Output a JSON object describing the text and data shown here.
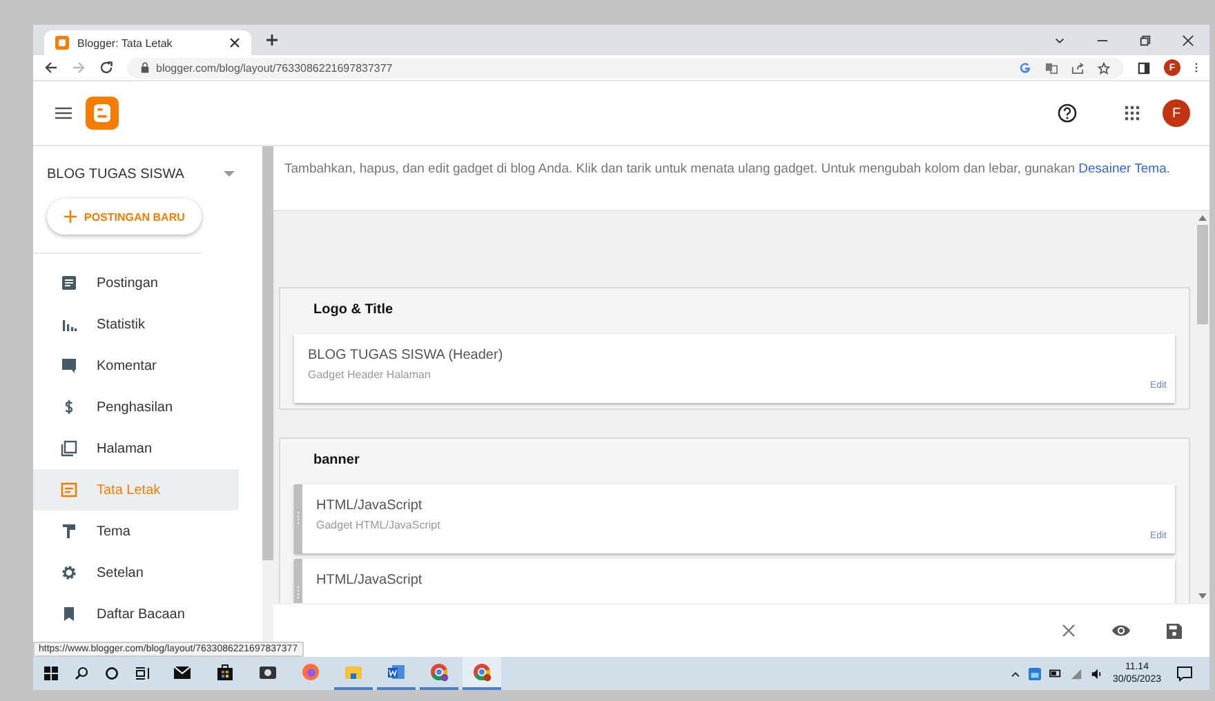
{
  "browser": {
    "tabs": [
      {
        "title": "Blogger: Tata Letak",
        "selected": true
      }
    ],
    "url": "blogger.com/blog/layout/7633086221697837377",
    "profile_initial": "F"
  },
  "header": {
    "avatar_initial": "F"
  },
  "sidebar": {
    "blog_title": "BLOG TUGAS SISWA",
    "new_post_button": "POSTINGAN BARU",
    "items": [
      {
        "label": "Postingan",
        "kind": "posts",
        "selected": false
      },
      {
        "label": "Statistik",
        "kind": "stats",
        "selected": false
      },
      {
        "label": "Komentar",
        "kind": "comments",
        "selected": false
      },
      {
        "label": "Penghasilan",
        "kind": "earnings",
        "selected": false
      },
      {
        "label": "Halaman",
        "kind": "pages",
        "selected": false
      },
      {
        "label": "Tata Letak",
        "kind": "layout",
        "selected": true
      },
      {
        "label": "Tema",
        "kind": "theme",
        "selected": false
      },
      {
        "label": "Setelan",
        "kind": "settings",
        "selected": false
      },
      {
        "label": "Daftar Bacaan",
        "kind": "reading",
        "selected": false
      }
    ]
  },
  "description": {
    "text": "Tambahkan, hapus, dan edit gadget di blog Anda. Klik dan tarik untuk menata ulang gadget. Untuk mengubah kolom dan lebar, gunakan",
    "link": "Desainer Tema",
    "after": "."
  },
  "sections": [
    {
      "title": "Logo & Title",
      "gadgets": [
        {
          "name": "BLOG TUGAS SISWA (Header)",
          "type": "Gadget Header Halaman",
          "edit": "Edit",
          "draggable": false
        }
      ]
    },
    {
      "title": "banner",
      "gadgets": [
        {
          "name": "HTML/JavaScript",
          "type": "Gadget HTML/JavaScript",
          "edit": "Edit",
          "draggable": true
        },
        {
          "name": "HTML/JavaScript",
          "draggable": true
        }
      ]
    }
  ],
  "status_url": "https://www.blogger.com/blog/layout/7633086221697837377",
  "taskbar": {
    "apps": [
      {
        "kind": "mail",
        "running": false,
        "selected": false
      },
      {
        "kind": "store",
        "running": false,
        "selected": false
      },
      {
        "kind": "camera",
        "running": false,
        "selected": false
      },
      {
        "kind": "firefox",
        "running": false,
        "selected": false
      },
      {
        "kind": "explorer",
        "running": true,
        "selected": false
      },
      {
        "kind": "word",
        "running": true,
        "selected": false
      },
      {
        "kind": "chrome",
        "running": true,
        "selected": false
      },
      {
        "kind": "chrome",
        "running": true,
        "selected": true
      }
    ],
    "time": "11.14",
    "date": "30/05/2023"
  }
}
